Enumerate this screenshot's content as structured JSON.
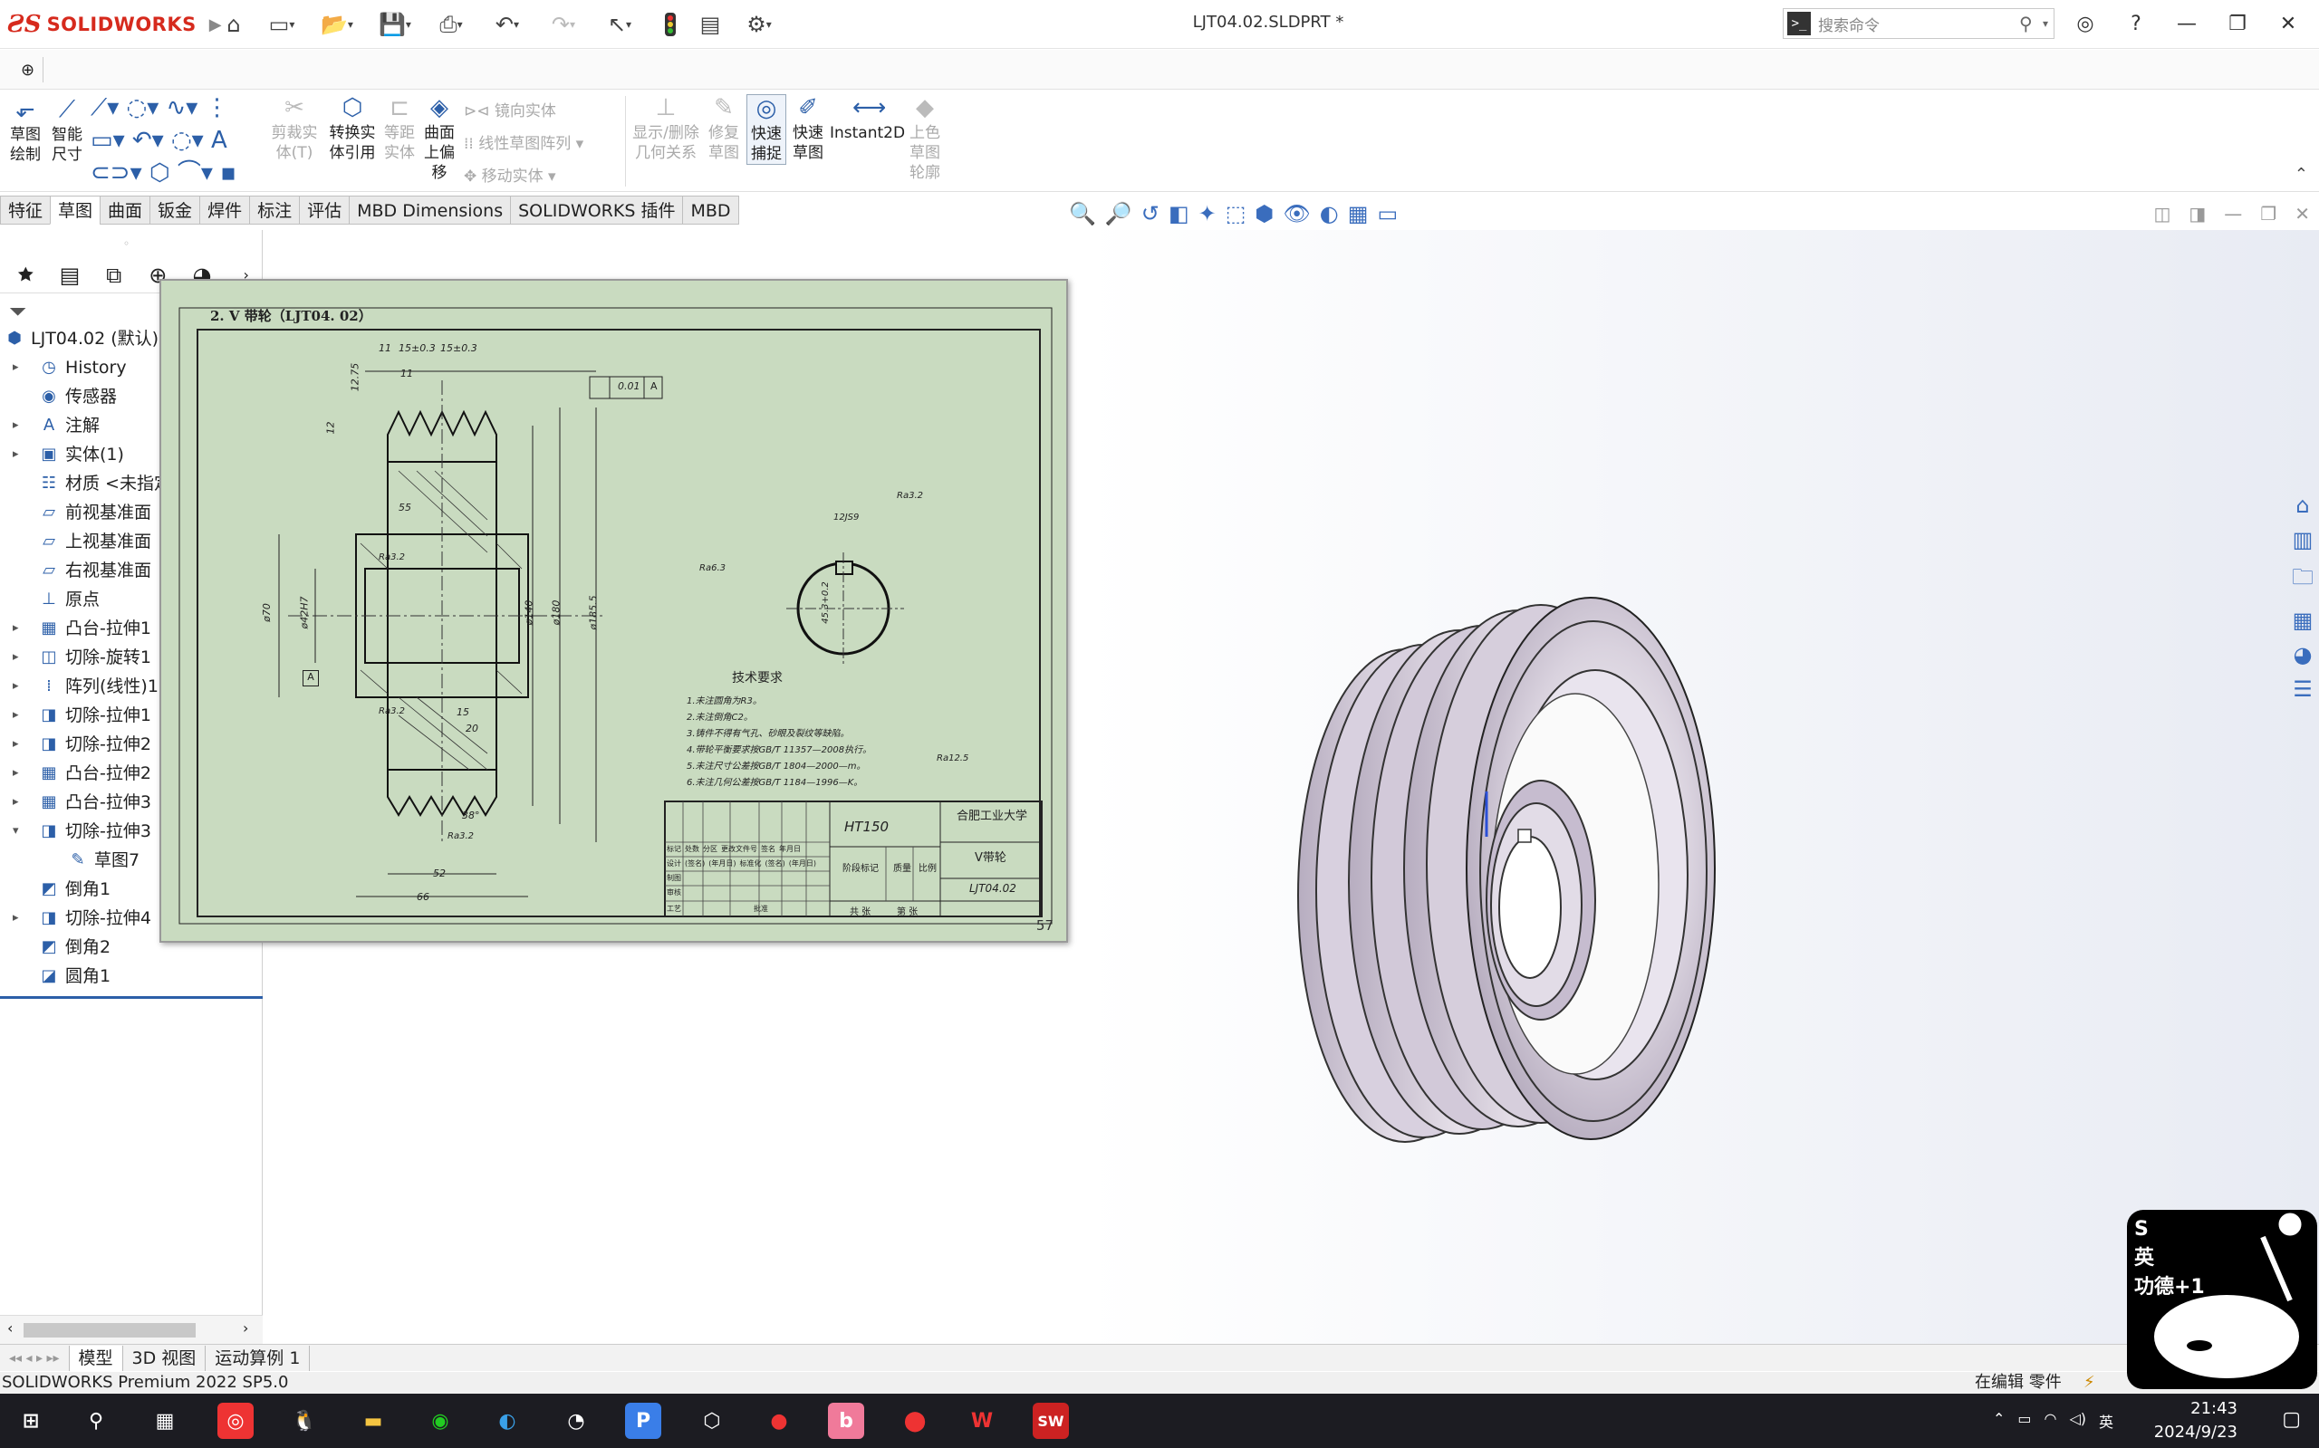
{
  "app": {
    "brand": "SOLIDWORKS",
    "title": "LJT04.02.SLDPRT *"
  },
  "search": {
    "placeholder": "搜索命令"
  },
  "ribbon": {
    "sketch_draw": "草图\n绘制",
    "smart_dim": "智能\n尺寸",
    "trim": "剪裁实\n体(T)",
    "convert": "转换实\n体引用",
    "offset": "等距\n实体",
    "surface_offset": "曲面\n上偏\n移",
    "mirror": "镜向实体",
    "linear_pattern": "线性草图阵列",
    "move": "移动实体",
    "relations": "显示/删除\n几何关系",
    "repair": "修复\n草图",
    "quick_snap": "快速\n捕捉",
    "quick_sketch": "快速\n草图",
    "instant2d": "Instant2D",
    "shaded": "上色\n草图\n轮廓"
  },
  "tabs": [
    "特征",
    "草图",
    "曲面",
    "钣金",
    "焊件",
    "标注",
    "评估",
    "MBD Dimensions",
    "SOLIDWORKS 插件",
    "MBD"
  ],
  "tree": [
    {
      "label": "LJT04.02 (默认) <<",
      "level": 0,
      "icon": "part-icon",
      "expand": ""
    },
    {
      "label": "History",
      "level": 1,
      "icon": "history-icon",
      "expand": "▸"
    },
    {
      "label": "传感器",
      "level": 1,
      "icon": "sensor-icon",
      "expand": ""
    },
    {
      "label": "注解",
      "level": 1,
      "icon": "annotation-icon",
      "expand": "▸"
    },
    {
      "label": "实体(1)",
      "level": 1,
      "icon": "solid-bodies-icon",
      "expand": "▸"
    },
    {
      "label": "材质 <未指定>",
      "level": 1,
      "icon": "material-icon",
      "expand": ""
    },
    {
      "label": "前视基准面",
      "level": 1,
      "icon": "plane-icon",
      "expand": ""
    },
    {
      "label": "上视基准面",
      "level": 1,
      "icon": "plane-icon",
      "expand": ""
    },
    {
      "label": "右视基准面",
      "level": 1,
      "icon": "plane-icon",
      "expand": ""
    },
    {
      "label": "原点",
      "level": 1,
      "icon": "origin-icon",
      "expand": ""
    },
    {
      "label": "凸台-拉伸1",
      "level": 1,
      "icon": "boss-extrude-icon",
      "expand": "▸"
    },
    {
      "label": "切除-旋转1",
      "level": 1,
      "icon": "cut-revolve-icon",
      "expand": "▸"
    },
    {
      "label": "阵列(线性)1",
      "level": 1,
      "icon": "linear-pattern-icon",
      "expand": "▸"
    },
    {
      "label": "切除-拉伸1",
      "level": 1,
      "icon": "cut-extrude-icon",
      "expand": "▸"
    },
    {
      "label": "切除-拉伸2",
      "level": 1,
      "icon": "cut-extrude-icon",
      "expand": "▸"
    },
    {
      "label": "凸台-拉伸2",
      "level": 1,
      "icon": "boss-extrude-icon",
      "expand": "▸"
    },
    {
      "label": "凸台-拉伸3",
      "level": 1,
      "icon": "boss-extrude-icon",
      "expand": "▸"
    },
    {
      "label": "切除-拉伸3",
      "level": 1,
      "icon": "cut-extrude-icon",
      "expand": "▾"
    },
    {
      "label": "草图7",
      "level": 2,
      "icon": "sketch-icon",
      "expand": ""
    },
    {
      "label": "倒角1",
      "level": 1,
      "icon": "chamfer-icon",
      "expand": ""
    },
    {
      "label": "切除-拉伸4",
      "level": 1,
      "icon": "cut-extrude-icon",
      "expand": "▸"
    },
    {
      "label": "倒角2",
      "level": 1,
      "icon": "chamfer-icon",
      "expand": ""
    },
    {
      "label": "圆角1",
      "level": 1,
      "icon": "fillet-icon",
      "expand": ""
    }
  ],
  "drawing": {
    "caption": "2. V 带轮（LJT04. 02）",
    "page": "57",
    "dims": {
      "d11": "11",
      "d15": "15±0.3",
      "d15b": "15±0.3",
      "d11b": "11",
      "d12_75": "12.75",
      "d12": "12",
      "d55": "55",
      "phi70": "ø70",
      "phi42": "ø42H7",
      "phi140": "ø140",
      "phi180": "ø180",
      "phi185": "ø185.5",
      "d15c": "15",
      "d20": "20",
      "d38": "38°",
      "d52": "52",
      "d66": "66",
      "tol": "0.01",
      "datum": "A",
      "datum_box": "A",
      "ra32a": "Ra3.2",
      "ra32b": "Ra3.2",
      "ra32c": "Ra3.2",
      "ra63": "Ra6.3",
      "ra32d": "Ra3.2",
      "ra125": "Ra12.5",
      "keyw": "12JS9",
      "keyh": "45.3+0.2"
    },
    "notes_title": "技术要求",
    "notes": [
      "1.未注圆角为R3。",
      "2.未注倒角C2。",
      "3.铸件不得有气孔、砂眼及裂纹等缺陷。",
      "4.带轮平衡要求按GB/T 11357—2008执行。",
      "5.未注尺寸公差按GB/T 1804—2000—m。",
      "6.未注几何公差按GB/T 1184—1996—K。"
    ],
    "title_block": {
      "material": "HT150",
      "school": "合肥工业大学",
      "part": "V带轮",
      "code": "LJT04.02",
      "row1": [
        "标记",
        "处数",
        "分区",
        "更改文件号",
        "签名",
        "年月日"
      ],
      "row2": [
        "设计",
        "(签名)",
        "(年月日)",
        "标准化",
        "(签名)",
        "(年月日)"
      ],
      "row3": [
        "制图"
      ],
      "row4": [
        "审核"
      ],
      "row5": [
        "工艺",
        "",
        "",
        "批准"
      ],
      "stage": "阶段标记",
      "weight": "质量",
      "scale": "比例",
      "sheets": "共  张",
      "sheet": "第  张"
    }
  },
  "bottom_tabs": [
    "模型",
    "3D 视图",
    "运动算例 1"
  ],
  "status": {
    "left": "SOLIDWORKS Premium 2022 SP5.0",
    "right": "在编辑 零件"
  },
  "taskbar": {
    "time": "21:43",
    "date": "2024/9/23",
    "ime": "英"
  },
  "mascot": {
    "text": "S\n英\n功德+1"
  },
  "colors": {
    "accent": "#2c5fa8",
    "brand_red": "#d62a1d",
    "drawing_bg": "#c9dbc0",
    "pulley": "#c9bfd0"
  }
}
